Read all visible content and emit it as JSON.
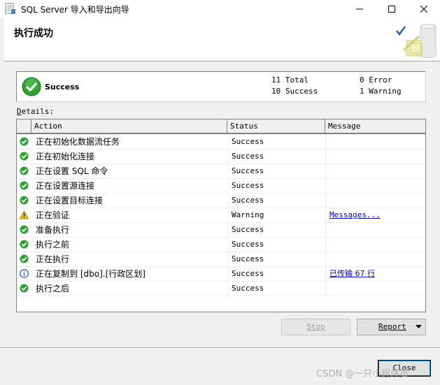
{
  "window": {
    "title": "SQL Server 导入和导出向导"
  },
  "header": {
    "title": "执行成功"
  },
  "summary": {
    "status": "Success",
    "total_label": "11 Total",
    "success_label": "10 Success",
    "error_label": "0 Error",
    "warning_label": "1 Warning"
  },
  "details": {
    "label_first": "D",
    "label_rest": "etails:"
  },
  "grid": {
    "columns": [
      "Action",
      "Status",
      "Message"
    ],
    "rows": [
      {
        "icon": "success-icon",
        "action": "正在初始化数据流任务",
        "status": "Success",
        "message": ""
      },
      {
        "icon": "success-icon",
        "action": "正在初始化连接",
        "status": "Success",
        "message": ""
      },
      {
        "icon": "success-icon",
        "action": "正在设置 SQL 命令",
        "status": "Success",
        "message": ""
      },
      {
        "icon": "success-icon",
        "action": "正在设置源连接",
        "status": "Success",
        "message": ""
      },
      {
        "icon": "success-icon",
        "action": "正在设置目标连接",
        "status": "Success",
        "message": ""
      },
      {
        "icon": "warning-icon",
        "action": "正在验证",
        "status": "Warning",
        "message": "Messages..."
      },
      {
        "icon": "success-icon",
        "action": "准备执行",
        "status": "Success",
        "message": ""
      },
      {
        "icon": "success-icon",
        "action": "执行之前",
        "status": "Success",
        "message": ""
      },
      {
        "icon": "success-icon",
        "action": "正在执行",
        "status": "Success",
        "message": ""
      },
      {
        "icon": "info-icon",
        "action": "正在复制到 [dbo].[行政区划]",
        "status": "Success",
        "message": "已传输 67 行"
      },
      {
        "icon": "success-icon",
        "action": "执行之后",
        "status": "Success",
        "message": ""
      }
    ]
  },
  "buttons": {
    "stop": "Stop",
    "report": "Report",
    "close": "Close"
  },
  "watermark": "CSDN @一只小程序员",
  "colors": {
    "success": "#2ea12e",
    "warning": "#f5c400",
    "info": "#1e5fb4",
    "link": "#0000cc"
  }
}
